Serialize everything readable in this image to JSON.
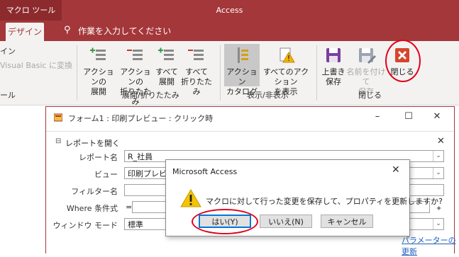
{
  "ribbon": {
    "contextual_tab": "マクロ ツール",
    "app_title": "Access",
    "active_tab": "デザイン",
    "tell_me": "作業を入力してください",
    "left_partial": [
      "イン",
      "Visual Basic に変換",
      "ール"
    ],
    "buttons": {
      "expand": "アクションの\n展開",
      "collapse": "アクションの\n折りたたみ",
      "expand_all": "すべて\n展開",
      "collapse_all": "すべて\n折りたたみ",
      "catalog": "アクション\nカタログ",
      "show_all": "すべてのアクション\nを表示",
      "save": "上書き\n保存",
      "save_as": "名前を付けて\n保存",
      "close": "閉じる"
    },
    "groups": {
      "expand_collapse": "展開/折りたたみ",
      "show_hide": "表示/非表示",
      "close": "閉じる"
    }
  },
  "form": {
    "title": "フォーム1 : 印刷プレビュー : クリック時",
    "section": "レポートを開く",
    "rows": [
      {
        "label": "レポート名",
        "value": "R_社員"
      },
      {
        "label": "ビュー",
        "value": "印刷プレビュー"
      },
      {
        "label": "フィルター名",
        "value": ""
      },
      {
        "label": "Where 条件式",
        "value": "="
      },
      {
        "label": "ウィンドウ モード",
        "value": "標準"
      }
    ],
    "param_link": "パラメーターの更新"
  },
  "dialog": {
    "title": "Microsoft Access",
    "message": "マクロに対して行った変更を保存して、プロパティを更新しますか?",
    "yes": "はい(Y)",
    "no": "いいえ(N)",
    "cancel": "キャンセル"
  },
  "colors": {
    "access_red": "#a4373a",
    "highlight_red": "#e2001a"
  }
}
